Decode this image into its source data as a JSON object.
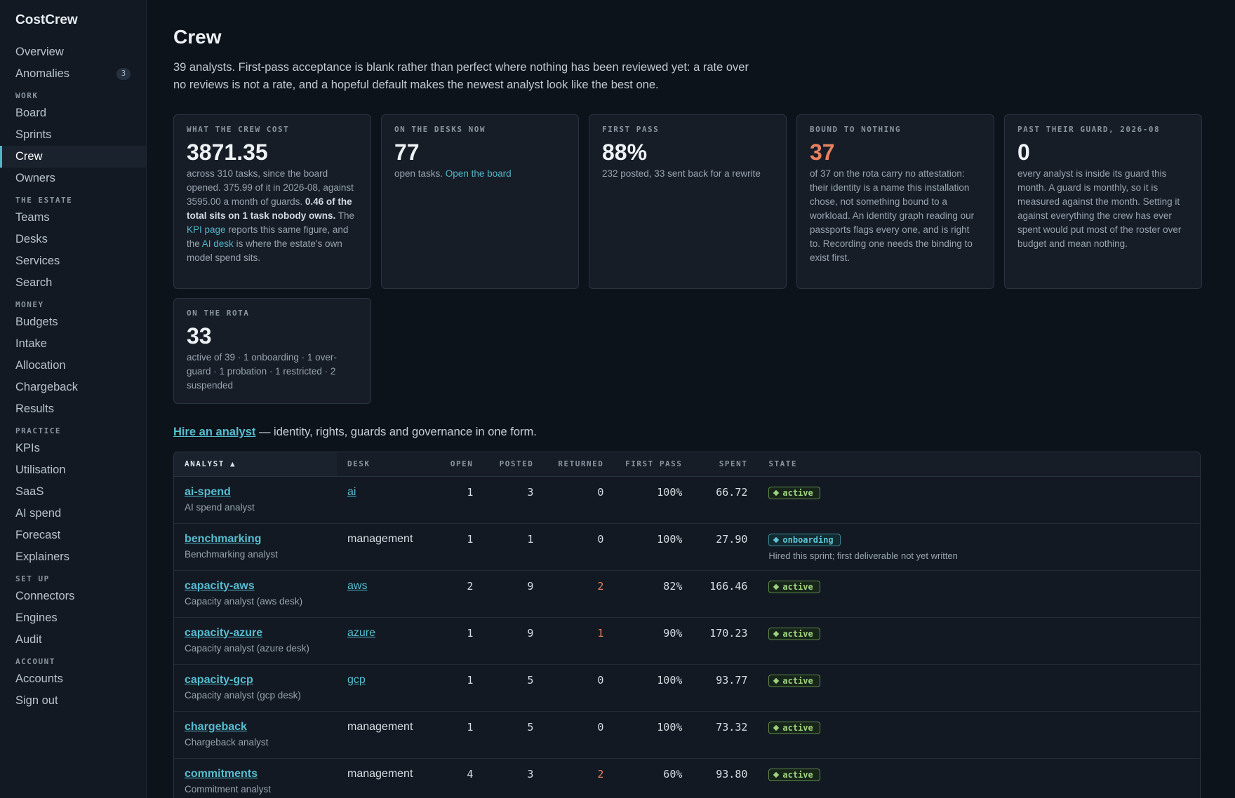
{
  "brand": "CostCrew",
  "nav": {
    "top": [
      {
        "label": "Overview"
      },
      {
        "label": "Anomalies",
        "badge": "3"
      }
    ],
    "sections": [
      {
        "title": "WORK",
        "items": [
          "Board",
          "Sprints",
          "Crew",
          "Owners"
        ]
      },
      {
        "title": "THE ESTATE",
        "items": [
          "Teams",
          "Desks",
          "Services",
          "Search"
        ]
      },
      {
        "title": "MONEY",
        "items": [
          "Budgets",
          "Intake",
          "Allocation",
          "Chargeback",
          "Results"
        ]
      },
      {
        "title": "PRACTICE",
        "items": [
          "KPIs",
          "Utilisation",
          "SaaS",
          "AI spend",
          "Forecast",
          "Explainers"
        ]
      },
      {
        "title": "SET UP",
        "items": [
          "Connectors",
          "Engines",
          "Audit"
        ]
      },
      {
        "title": "ACCOUNT",
        "items": [
          "Accounts",
          "Sign out"
        ]
      }
    ],
    "active": "Crew"
  },
  "page": {
    "title": "Crew",
    "intro": "39 analysts. First-pass acceptance is blank rather than perfect where nothing has been reviewed yet: a rate over no reviews is not a rate, and a hopeful default makes the newest analyst look like the best one."
  },
  "cards": {
    "cost": {
      "label": "WHAT THE CREW COST",
      "value": "3871.35",
      "text_1": "across 310 tasks, since the board opened. 375.99 of it in 2026-08, against 3595.00 a month of guards.",
      "text_bold": "0.46 of the total sits on 1 task nobody owns.",
      "text_2": " The ",
      "link_1": "KPI page",
      "text_3": " reports this same figure, and the ",
      "link_2": "AI desk",
      "text_4": " is where the estate's own model spend sits."
    },
    "desks": {
      "label": "ON THE DESKS NOW",
      "value": "77",
      "text": "open tasks. ",
      "link": "Open the board"
    },
    "first_pass": {
      "label": "FIRST PASS",
      "value": "88%",
      "text": "232 posted, 33 sent back for a rewrite"
    },
    "bound": {
      "label": "BOUND TO NOTHING",
      "value": "37",
      "text": "of 37 on the rota carry no attestation: their identity is a name this installation chose, not something bound to a workload. An identity graph reading our passports flags every one, and is right to. Recording one needs the binding to exist first."
    },
    "guard": {
      "label": "PAST THEIR GUARD, 2026-08",
      "value": "0",
      "text": "every analyst is inside its guard this month. A guard is monthly, so it is measured against the month. Setting it against everything the crew has ever spent would put most of the roster over budget and mean nothing."
    },
    "rota": {
      "label": "ON THE ROTA",
      "value": "33",
      "text": "active of 39 · 1 onboarding · 1 over-guard · 1 probation · 1 restricted · 2 suspended"
    }
  },
  "hire": {
    "link": "Hire an analyst",
    "text": " — identity, rights, guards and governance in one form."
  },
  "table": {
    "headers": {
      "analyst": "ANALYST ▲",
      "desk": "DESK",
      "open": "OPEN",
      "posted": "POSTED",
      "returned": "RETURNED",
      "first_pass": "FIRST PASS",
      "spent": "SPENT",
      "state": "STATE"
    },
    "rows": [
      {
        "name": "ai-spend",
        "sub": "AI spend analyst",
        "desk": "ai",
        "desk_link": true,
        "open": "1",
        "posted": "3",
        "returned": "0",
        "first_pass": "100%",
        "spent": "66.72",
        "state": "active",
        "note": ""
      },
      {
        "name": "benchmarking",
        "sub": "Benchmarking analyst",
        "desk": "management",
        "desk_link": false,
        "open": "1",
        "posted": "1",
        "returned": "0",
        "first_pass": "100%",
        "spent": "27.90",
        "state": "onboarding",
        "note": "Hired this sprint; first deliverable not yet written"
      },
      {
        "name": "capacity-aws",
        "sub": "Capacity analyst (aws desk)",
        "desk": "aws",
        "desk_link": true,
        "open": "2",
        "posted": "9",
        "returned": "2",
        "first_pass": "82%",
        "spent": "166.46",
        "state": "active",
        "note": ""
      },
      {
        "name": "capacity-azure",
        "sub": "Capacity analyst (azure desk)",
        "desk": "azure",
        "desk_link": true,
        "open": "1",
        "posted": "9",
        "returned": "1",
        "first_pass": "90%",
        "spent": "170.23",
        "state": "active",
        "note": ""
      },
      {
        "name": "capacity-gcp",
        "sub": "Capacity analyst (gcp desk)",
        "desk": "gcp",
        "desk_link": true,
        "open": "1",
        "posted": "5",
        "returned": "0",
        "first_pass": "100%",
        "spent": "93.77",
        "state": "active",
        "note": ""
      },
      {
        "name": "chargeback",
        "sub": "Chargeback analyst",
        "desk": "management",
        "desk_link": false,
        "open": "1",
        "posted": "5",
        "returned": "0",
        "first_pass": "100%",
        "spent": "73.32",
        "state": "active",
        "note": ""
      },
      {
        "name": "commitments",
        "sub": "Commitment analyst",
        "desk": "management",
        "desk_link": false,
        "open": "4",
        "posted": "3",
        "returned": "2",
        "first_pass": "60%",
        "spent": "93.80",
        "state": "active",
        "note": ""
      }
    ]
  }
}
